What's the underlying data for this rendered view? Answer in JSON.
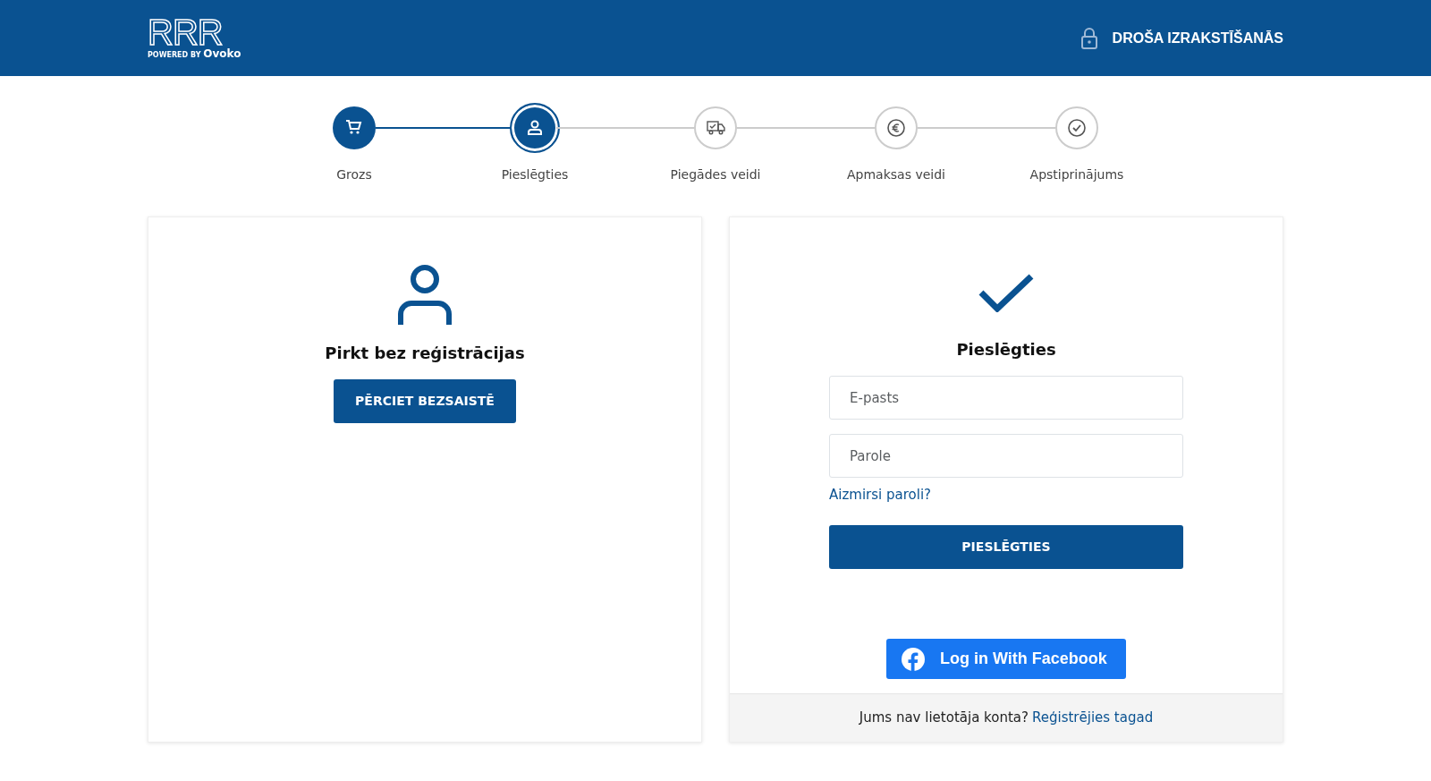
{
  "header": {
    "logo": "RRR",
    "logo_tagline_prefix": "POWERED BY",
    "logo_tagline_brand": "Ovoko",
    "secure_label": "DROŠA IZRAKSTĪŠANĀS"
  },
  "steps": [
    {
      "label": "Grozs",
      "completed": true,
      "selected": false,
      "kind": "cart"
    },
    {
      "label": "Pieslēgties",
      "completed": false,
      "selected": true,
      "kind": "user"
    },
    {
      "label": "Piegādes veidi",
      "completed": false,
      "selected": false,
      "kind": "truck"
    },
    {
      "label": "Apmaksas veidi",
      "completed": false,
      "selected": false,
      "kind": "euro"
    },
    {
      "label": "Apstiprinājums",
      "completed": false,
      "selected": false,
      "kind": "check"
    }
  ],
  "guest": {
    "title": "Pirkt bez reģistrācijas",
    "button": "PĒRCIET BEZSAISTĒ"
  },
  "login": {
    "title": "Pieslēgties",
    "email_placeholder": "E-pasts",
    "password_placeholder": "Parole",
    "forgot_link": "Aizmirsi paroli?",
    "button": "PIESLĒGTIES",
    "facebook_button": "Log in With Facebook",
    "footer_text": "Jums nav lietotāja konta?",
    "register_link": "Reģistrējies tagad"
  }
}
